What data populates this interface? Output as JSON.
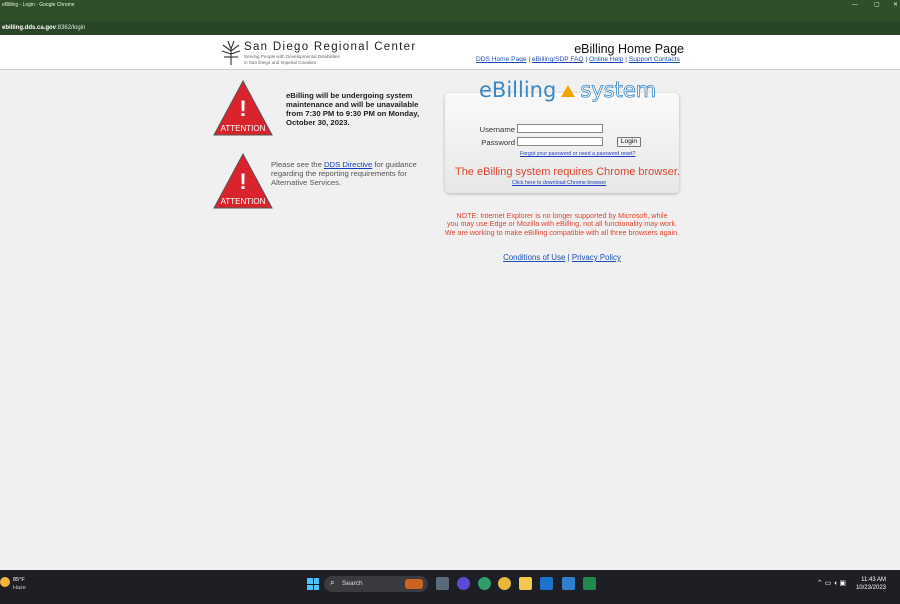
{
  "browser": {
    "window_title": "eBilling - Login - Google Chrome",
    "url_host": "ebilling.dds.ca.gov",
    "url_rest": ":8362/login"
  },
  "header": {
    "org_name": "San Diego Regional Center",
    "org_sub1": "Serving People with Developmental Disabilities",
    "org_sub2": "in San Diego and Imperial Counties",
    "page_heading": "eBilling Home Page",
    "nav": [
      {
        "label": "DDS Home Page"
      },
      {
        "label": "eBilling/SDP FAQ"
      },
      {
        "label": "Online Help"
      },
      {
        "label": "Support Contacts"
      }
    ],
    "nav_sep": "|"
  },
  "attention": {
    "badge_label": "ATTENTION",
    "mark": "!",
    "notice1": "eBilling will be undergoing system maintenance and will be unavailable from 7:30 PM to 9:30 PM on Monday, October 30, 2023.",
    "notice2_before": "Please see the ",
    "notice2_link": "DDS Directive",
    "notice2_after": " for guidance regarding the reporting requirements for Alternative Services."
  },
  "login": {
    "logo_left": "eBilling",
    "logo_right": "system",
    "username_label": "Username",
    "password_label": "Password",
    "username_value": "",
    "password_value": "",
    "login_button": "Login",
    "forgot_link": "Forgot your password or need a password reset?",
    "browser_requirement": "The eBilling system requires Chrome browser.",
    "download_link": "Click here to download Chrome browser"
  },
  "note": {
    "line1": "NOTE: Internet Explorer is no longer supported by Microsoft, while",
    "line2": "you may use Edge or Mozilla with eBilling, not all functionality may work.",
    "line3": "We are working to make eBilling compatible with all three browsers again."
  },
  "footer": {
    "conditions": "Conditions of Use",
    "sep": "|",
    "privacy": "Privacy Policy"
  },
  "taskbar": {
    "temperature": "85°F",
    "condition": "Haze",
    "search_label": "Search",
    "time": "11:43 AM",
    "date": "10/23/2023"
  },
  "colors": {
    "alert_red": "#d9232d",
    "link_blue": "#1a4fb3",
    "notice_red": "#e0452f",
    "logo_blue": "#3a89c6",
    "logo_triangle": "#f2a500"
  }
}
